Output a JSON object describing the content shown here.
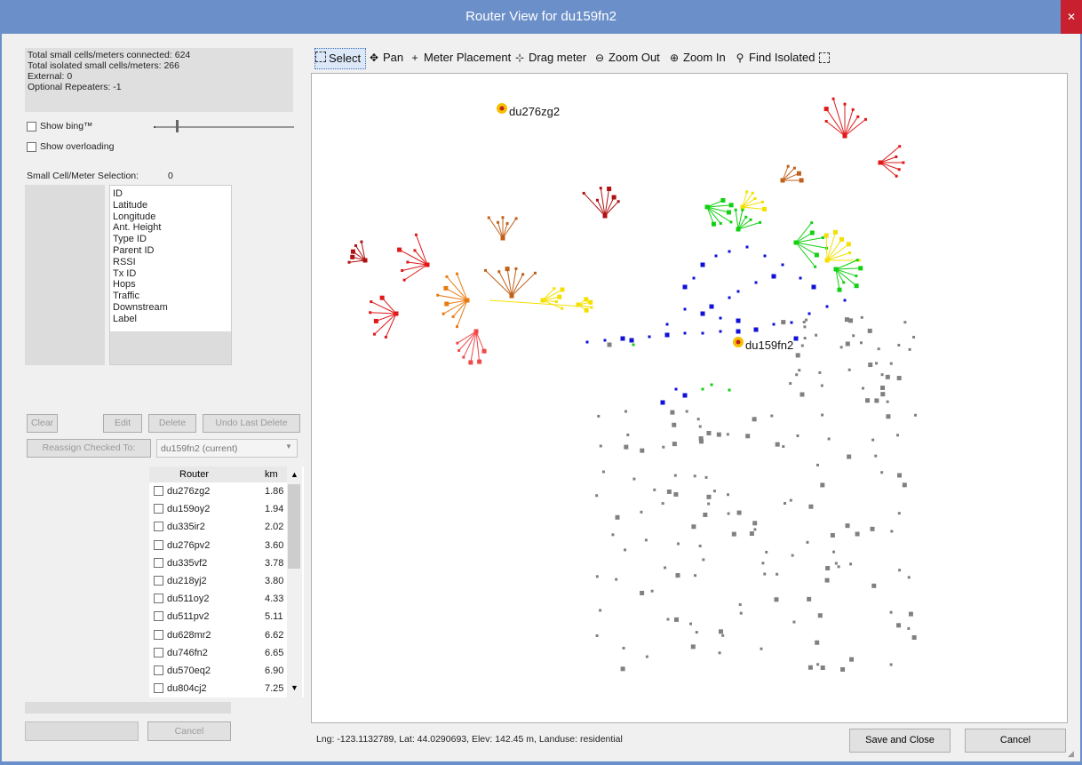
{
  "window": {
    "title": "Router View for du159fn2",
    "close_glyph": "✕"
  },
  "stats": {
    "lines": [
      "Total small cells/meters connected: 624",
      "Total isolated small cells/meters: 266",
      "External: 0",
      "Optional Repeaters: -1"
    ]
  },
  "options": {
    "show_bing": "Show bing™",
    "show_overloading": "Show overloading",
    "show_bing_checked": false,
    "show_overloading_checked": false
  },
  "selection": {
    "label": "Small Cell/Meter Selection:",
    "count": "0",
    "fields": [
      "ID",
      "Latitude",
      "Longitude",
      "Ant. Height",
      "Type ID",
      "Parent ID",
      "RSSI",
      "Tx ID",
      "Hops",
      "Traffic",
      "Downstream",
      "Label"
    ]
  },
  "actions": {
    "clear": "Clear",
    "edit": "Edit",
    "delete": "Delete",
    "undo": "Undo Last Delete",
    "reassign": "Reassign Checked To:",
    "reassign_value": "du159fn2 (current)",
    "cancel": "Cancel"
  },
  "router_table": {
    "col_router": "Router",
    "col_km": "km",
    "rows": [
      {
        "name": "du276zg2",
        "km": "1.86"
      },
      {
        "name": "du159oy2",
        "km": "1.94"
      },
      {
        "name": "du335ir2",
        "km": "2.02"
      },
      {
        "name": "du276pv2",
        "km": "3.60"
      },
      {
        "name": "du335vf2",
        "km": "3.78"
      },
      {
        "name": "du218yj2",
        "km": "3.80"
      },
      {
        "name": "du511oy2",
        "km": "4.33"
      },
      {
        "name": "du511pv2",
        "km": "5.11"
      },
      {
        "name": "du628mr2",
        "km": "6.62"
      },
      {
        "name": "du746fn2",
        "km": "6.65"
      },
      {
        "name": "du570eq2",
        "km": "6.90"
      },
      {
        "name": "du804cj2",
        "km": "7.25"
      }
    ]
  },
  "toolbar": {
    "select": "Select",
    "pan": "Pan",
    "meter_placement": "Meter Placement",
    "drag_meter": "Drag meter",
    "zoom_out": "Zoom Out",
    "zoom_in": "Zoom In",
    "find_isolated": "Find Isolated"
  },
  "map": {
    "router_primary": "du159fn2",
    "router_secondary": "du276zg2",
    "colors": {
      "red": "#e01818",
      "darkred": "#b01010",
      "salmon": "#ef4a4a",
      "orange": "#e87a10",
      "brown": "#c0601a",
      "yellow": "#f4e000",
      "green": "#10d010",
      "blue": "#1010d8",
      "gray": "#808080",
      "router_ring": "#f5c000",
      "router_core": "#c02020"
    }
  },
  "status": {
    "text": "Lng: -123.1132789, Lat: 44.0290693, Elev: 142.45 m, Landuse: residential"
  },
  "footer": {
    "save_close": "Save and Close",
    "cancel": "Cancel"
  }
}
